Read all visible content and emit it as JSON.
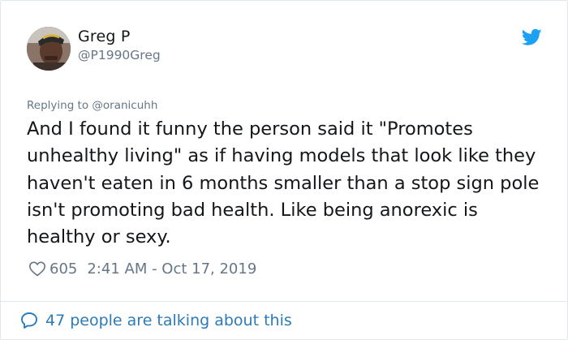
{
  "tweet": {
    "author_name": "Greg P",
    "author_handle": "@P1990Greg",
    "replying_to": "Replying to @oranicuhh",
    "text": "And I found it funny the person said it \"Promotes unhealthy living\" as if having models that look like they haven't eaten in 6 months smaller than a stop sign pole isn't promoting bad health. Like being anorexic is healthy or sexy.",
    "likes": "605",
    "timestamp": "2:41 AM - Oct 17, 2019",
    "talking_text": "47 people are talking about this"
  },
  "icons": {
    "brand": "twitter-bird-icon",
    "like": "heart-icon",
    "conversation": "speech-bubble-icon"
  },
  "colors": {
    "twitter_blue": "#1da1f2",
    "link_blue": "#2b7bb9",
    "text_primary": "#14171a",
    "text_secondary": "#657786",
    "border": "#e1e8ed"
  }
}
